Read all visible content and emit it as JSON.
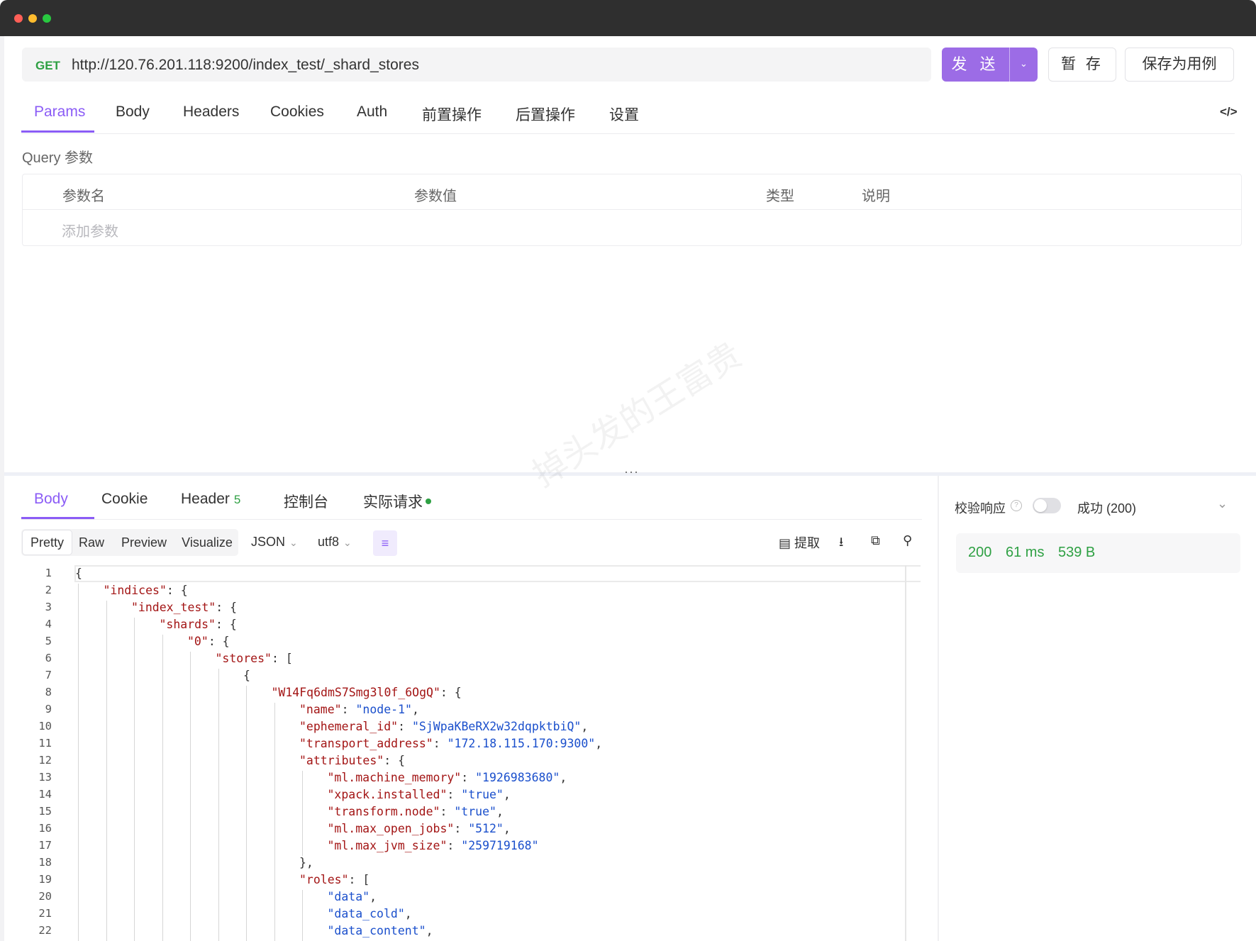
{
  "request": {
    "method": "GET",
    "url": "http://120.76.201.118:9200/index_test/_shard_stores",
    "send_label": "发 送",
    "save_label": "暂 存",
    "save_case_label": "保存为用例"
  },
  "request_tabs": [
    "Params",
    "Body",
    "Headers",
    "Cookies",
    "Auth",
    "前置操作",
    "后置操作",
    "设置"
  ],
  "params": {
    "title": "Query 参数",
    "headers": [
      "参数名",
      "参数值",
      "类型",
      "说明"
    ],
    "add_placeholder": "添加参数"
  },
  "response_tabs": {
    "body": "Body",
    "cookie": "Cookie",
    "header": "Header",
    "header_count": "5",
    "console": "控制台",
    "actual_request": "实际请求"
  },
  "view_modes": [
    "Pretty",
    "Raw",
    "Preview",
    "Visualize"
  ],
  "format": "JSON",
  "encoding": "utf8",
  "extract_label": "提取",
  "validate": {
    "label": "校验响应",
    "enabled": false,
    "status_option": "成功 (200)"
  },
  "stats": {
    "status": "200",
    "time": "61 ms",
    "size": "539 B"
  },
  "watermark": "掉头发的王富贵",
  "code_lines": [
    {
      "n": "1",
      "indent": 0,
      "text": "{"
    },
    {
      "n": "2",
      "indent": 1,
      "key": "\"indices\"",
      "rest": ": {"
    },
    {
      "n": "3",
      "indent": 2,
      "key": "\"index_test\"",
      "rest": ": {"
    },
    {
      "n": "4",
      "indent": 3,
      "key": "\"shards\"",
      "rest": ": {"
    },
    {
      "n": "5",
      "indent": 4,
      "key": "\"0\"",
      "rest": ": {"
    },
    {
      "n": "6",
      "indent": 5,
      "key": "\"stores\"",
      "rest": ": ["
    },
    {
      "n": "7",
      "indent": 6,
      "text": "{"
    },
    {
      "n": "8",
      "indent": 7,
      "key": "\"W14Fq6dmS7Smg3l0f_6OgQ\"",
      "rest": ": {"
    },
    {
      "n": "9",
      "indent": 8,
      "key": "\"name\"",
      "sep": ": ",
      "val": "\"node-1\"",
      "tail": ","
    },
    {
      "n": "10",
      "indent": 8,
      "key": "\"ephemeral_id\"",
      "sep": ": ",
      "val": "\"SjWpaKBeRX2w32dqpktbiQ\"",
      "tail": ","
    },
    {
      "n": "11",
      "indent": 8,
      "key": "\"transport_address\"",
      "sep": ": ",
      "val": "\"172.18.115.170:9300\"",
      "tail": ","
    },
    {
      "n": "12",
      "indent": 8,
      "key": "\"attributes\"",
      "rest": ": {"
    },
    {
      "n": "13",
      "indent": 9,
      "key": "\"ml.machine_memory\"",
      "sep": ": ",
      "val": "\"1926983680\"",
      "tail": ","
    },
    {
      "n": "14",
      "indent": 9,
      "key": "\"xpack.installed\"",
      "sep": ": ",
      "val": "\"true\"",
      "tail": ","
    },
    {
      "n": "15",
      "indent": 9,
      "key": "\"transform.node\"",
      "sep": ": ",
      "val": "\"true\"",
      "tail": ","
    },
    {
      "n": "16",
      "indent": 9,
      "key": "\"ml.max_open_jobs\"",
      "sep": ": ",
      "val": "\"512\"",
      "tail": ","
    },
    {
      "n": "17",
      "indent": 9,
      "key": "\"ml.max_jvm_size\"",
      "sep": ": ",
      "val": "\"259719168\"",
      "tail": ""
    },
    {
      "n": "18",
      "indent": 8,
      "text": "},"
    },
    {
      "n": "19",
      "indent": 8,
      "key": "\"roles\"",
      "rest": ": ["
    },
    {
      "n": "20",
      "indent": 9,
      "val": "\"data\"",
      "tail": ","
    },
    {
      "n": "21",
      "indent": 9,
      "val": "\"data_cold\"",
      "tail": ","
    },
    {
      "n": "22",
      "indent": 9,
      "val": "\"data_content\"",
      "tail": ","
    }
  ]
}
